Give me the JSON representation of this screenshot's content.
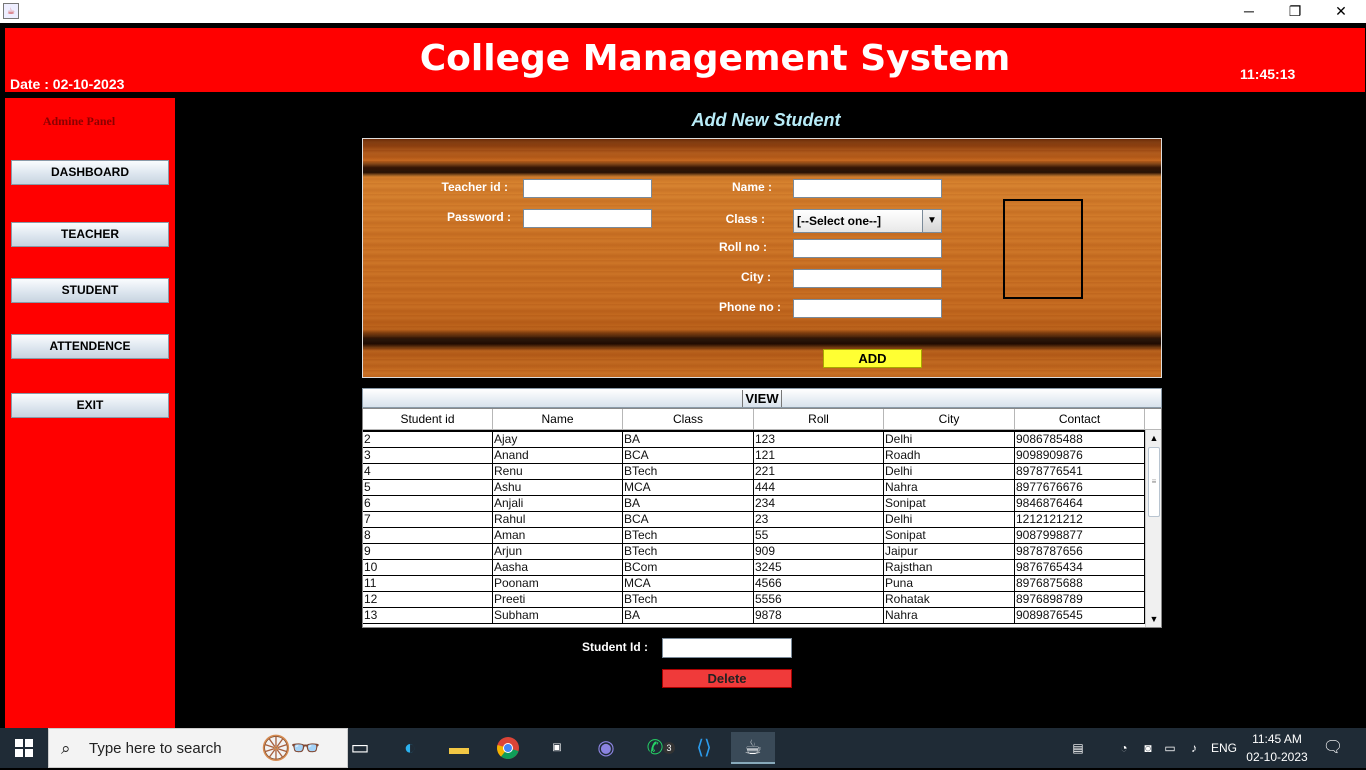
{
  "window": {
    "icon": "java-icon",
    "minimize": "─",
    "restore": "❐",
    "close": "✕"
  },
  "header": {
    "title": "College Management System",
    "date_label": "Date :  02-10-2023",
    "time": "11:45:13"
  },
  "sidebar": {
    "panel_label": "Admine Panel",
    "buttons": [
      "DASHBOARD",
      "TEACHER",
      "STUDENT",
      "ATTENDENCE",
      "EXIT"
    ]
  },
  "form": {
    "heading": "Add New Student",
    "teacher_id_label": "Teacher id :",
    "password_label": "Password :",
    "name_label": "Name :",
    "class_label": "Class :",
    "class_selected": "[--Select one--]",
    "roll_label": "Roll no :",
    "city_label": "City :",
    "phone_label": "Phone no :",
    "add_label": "ADD"
  },
  "table": {
    "view_label": "VIEW",
    "columns": [
      "Student id",
      "Name",
      "Class",
      "Roll",
      "City",
      "Contact"
    ],
    "rows": [
      [
        "2",
        "Ajay",
        "BA",
        "123",
        "Delhi",
        "9086785488"
      ],
      [
        "3",
        "Anand",
        "BCA",
        "121",
        "Roadh",
        "9098909876"
      ],
      [
        "4",
        "Renu",
        "BTech",
        "221",
        "Delhi",
        "8978776541"
      ],
      [
        "5",
        "Ashu",
        "MCA",
        "444",
        "Nahra",
        "8977676676"
      ],
      [
        "6",
        "Anjali",
        "BA",
        "234",
        "Sonipat",
        "9846876464"
      ],
      [
        "7",
        "Rahul",
        "BCA",
        "23",
        "Delhi",
        "1212121212"
      ],
      [
        "8",
        "Aman",
        "BTech",
        "55",
        "Sonipat",
        "9087998877"
      ],
      [
        "9",
        "Arjun",
        "BTech",
        "909",
        "Jaipur",
        "9878787656"
      ],
      [
        "10",
        "Aasha",
        "BCom",
        "3245",
        "Rajsthan",
        "9876765434"
      ],
      [
        "11",
        "Poonam",
        "MCA",
        "4566",
        "Puna",
        "8976875688"
      ],
      [
        "12",
        "Preeti",
        "BTech",
        "5556",
        "Rohatak",
        "8976898789"
      ],
      [
        "13",
        "Subham",
        "BA",
        "9878",
        "Nahra",
        "9089876545"
      ]
    ]
  },
  "delete_area": {
    "student_id_label": "Student Id :",
    "delete_label": "Delete"
  },
  "taskbar": {
    "search_placeholder": "Type here to search",
    "whatsapp_badge": "3",
    "lang": "ENG",
    "time": "11:45 AM",
    "date": "02-10-2023"
  }
}
